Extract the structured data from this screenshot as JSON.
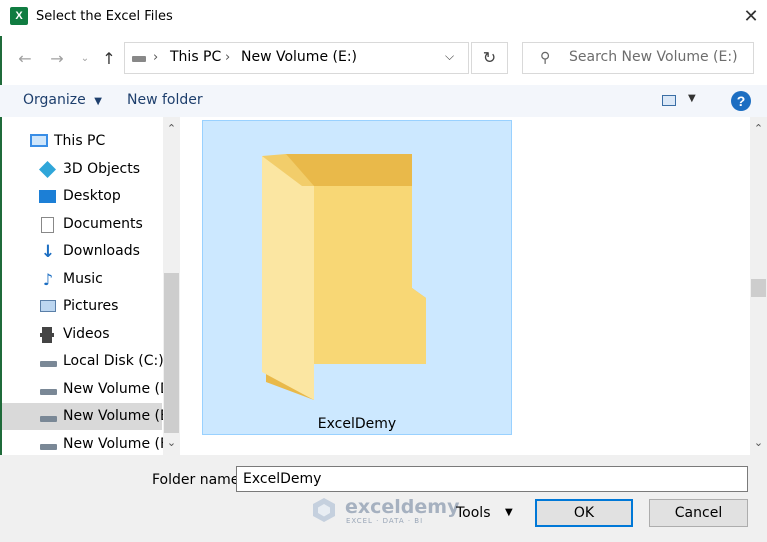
{
  "window": {
    "title": "Select the Excel Files",
    "app_icon_letter": "X"
  },
  "nav": {
    "path": [
      "This PC",
      "New Volume (E:)"
    ],
    "search_placeholder": "Search New Volume (E:)"
  },
  "toolbar": {
    "organize_label": "Organize",
    "new_folder_label": "New folder",
    "help_label": "?"
  },
  "sidebar": {
    "items": [
      {
        "label": "This PC",
        "icon": "computer-icon"
      },
      {
        "label": "3D Objects",
        "icon": "cube-icon"
      },
      {
        "label": "Desktop",
        "icon": "desktop-icon"
      },
      {
        "label": "Documents",
        "icon": "document-icon"
      },
      {
        "label": "Downloads",
        "icon": "download-icon"
      },
      {
        "label": "Music",
        "icon": "music-icon"
      },
      {
        "label": "Pictures",
        "icon": "picture-icon"
      },
      {
        "label": "Videos",
        "icon": "video-icon"
      },
      {
        "label": "Local Disk (C:)",
        "icon": "drive-icon"
      },
      {
        "label": "New Volume (D:",
        "icon": "drive-icon"
      },
      {
        "label": "New Volume (E:)",
        "icon": "drive-icon",
        "selected": true
      },
      {
        "label": "New Volume (F:)",
        "icon": "drive-icon"
      }
    ]
  },
  "content": {
    "folders": [
      {
        "name": "ExcelDemy",
        "selected": true
      }
    ]
  },
  "footer": {
    "folder_name_label": "Folder name:",
    "folder_name_value": "ExcelDemy",
    "tools_label": "Tools",
    "ok_label": "OK",
    "cancel_label": "Cancel"
  },
  "watermark": {
    "brand": "exceldemy",
    "tagline": "EXCEL · DATA · BI"
  },
  "colors": {
    "selection": "#cce8ff",
    "accent": "#0078d7",
    "folder": "#f8d775"
  }
}
